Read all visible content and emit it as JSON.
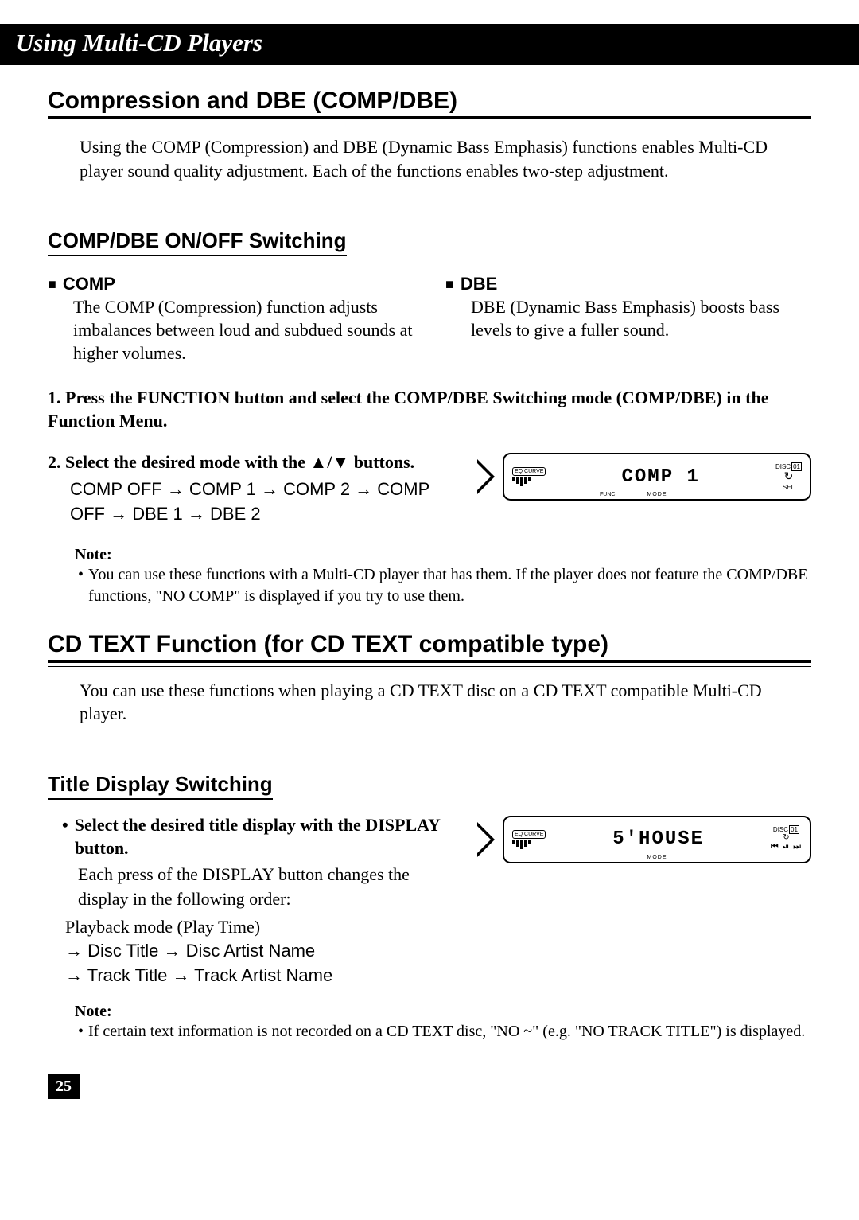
{
  "chapter_title": "Using Multi-CD Players",
  "section1": {
    "heading": "Compression and DBE (COMP/DBE)",
    "intro": "Using the COMP (Compression) and DBE (Dynamic Bass Emphasis) functions enables Multi-CD player sound quality adjustment. Each of the functions enables two-step adjustment.",
    "subheading": "COMP/DBE ON/OFF Switching",
    "comp_title": "COMP",
    "comp_body": "The COMP (Compression) function adjusts imbalances between loud and subdued sounds at higher volumes.",
    "dbe_title": "DBE",
    "dbe_body": "DBE (Dynamic Bass Emphasis) boosts bass levels to give a fuller sound.",
    "step1_num": "1.",
    "step1_title": "Press the FUNCTION button and select the COMP/DBE Switching mode (COMP/DBE) in the Function Menu.",
    "step2_num": "2.",
    "step2_title": "Select the desired mode with the ▲/▼ buttons.",
    "step2_body": "COMP OFF → COMP 1 → COMP 2 → COMP OFF → DBE 1 → DBE 2",
    "display_main": "COMP   1",
    "display_eq": "EQ CURVE",
    "display_disc": "DISC",
    "display_disc_num": "01",
    "display_func": "FUNC",
    "display_mode": "MODE",
    "display_sel": "SEL",
    "note_label": "Note:",
    "note_body": "You can use these functions with a Multi-CD player that has them. If the player does not feature the COMP/DBE functions, \"NO COMP\" is displayed if you try to use them."
  },
  "section2": {
    "heading": "CD TEXT Function (for CD TEXT compatible type)",
    "intro": "You can use these functions when playing a CD TEXT disc on a CD TEXT compatible Multi-CD player.",
    "subheading": "Title Display Switching",
    "step_title": "Select the desired title display with the DISPLAY button.",
    "step_body1": "Each press of the DISPLAY button changes the display in the following order:",
    "step_body2": "Playback mode (Play Time)",
    "step_body3": "→ Disc Title → Disc Artist Name",
    "step_body4": "→ Track Title → Track Artist Name",
    "display_main": "5'HOUSE",
    "display_eq": "EQ CURVE",
    "display_disc": "DISC",
    "display_disc_num": "01",
    "display_mode": "MODE",
    "note_label": "Note:",
    "note_body": "If certain text information is not recorded on a CD TEXT disc, \"NO ~\" (e.g. \"NO TRACK TITLE\") is displayed."
  },
  "page_number": "25"
}
